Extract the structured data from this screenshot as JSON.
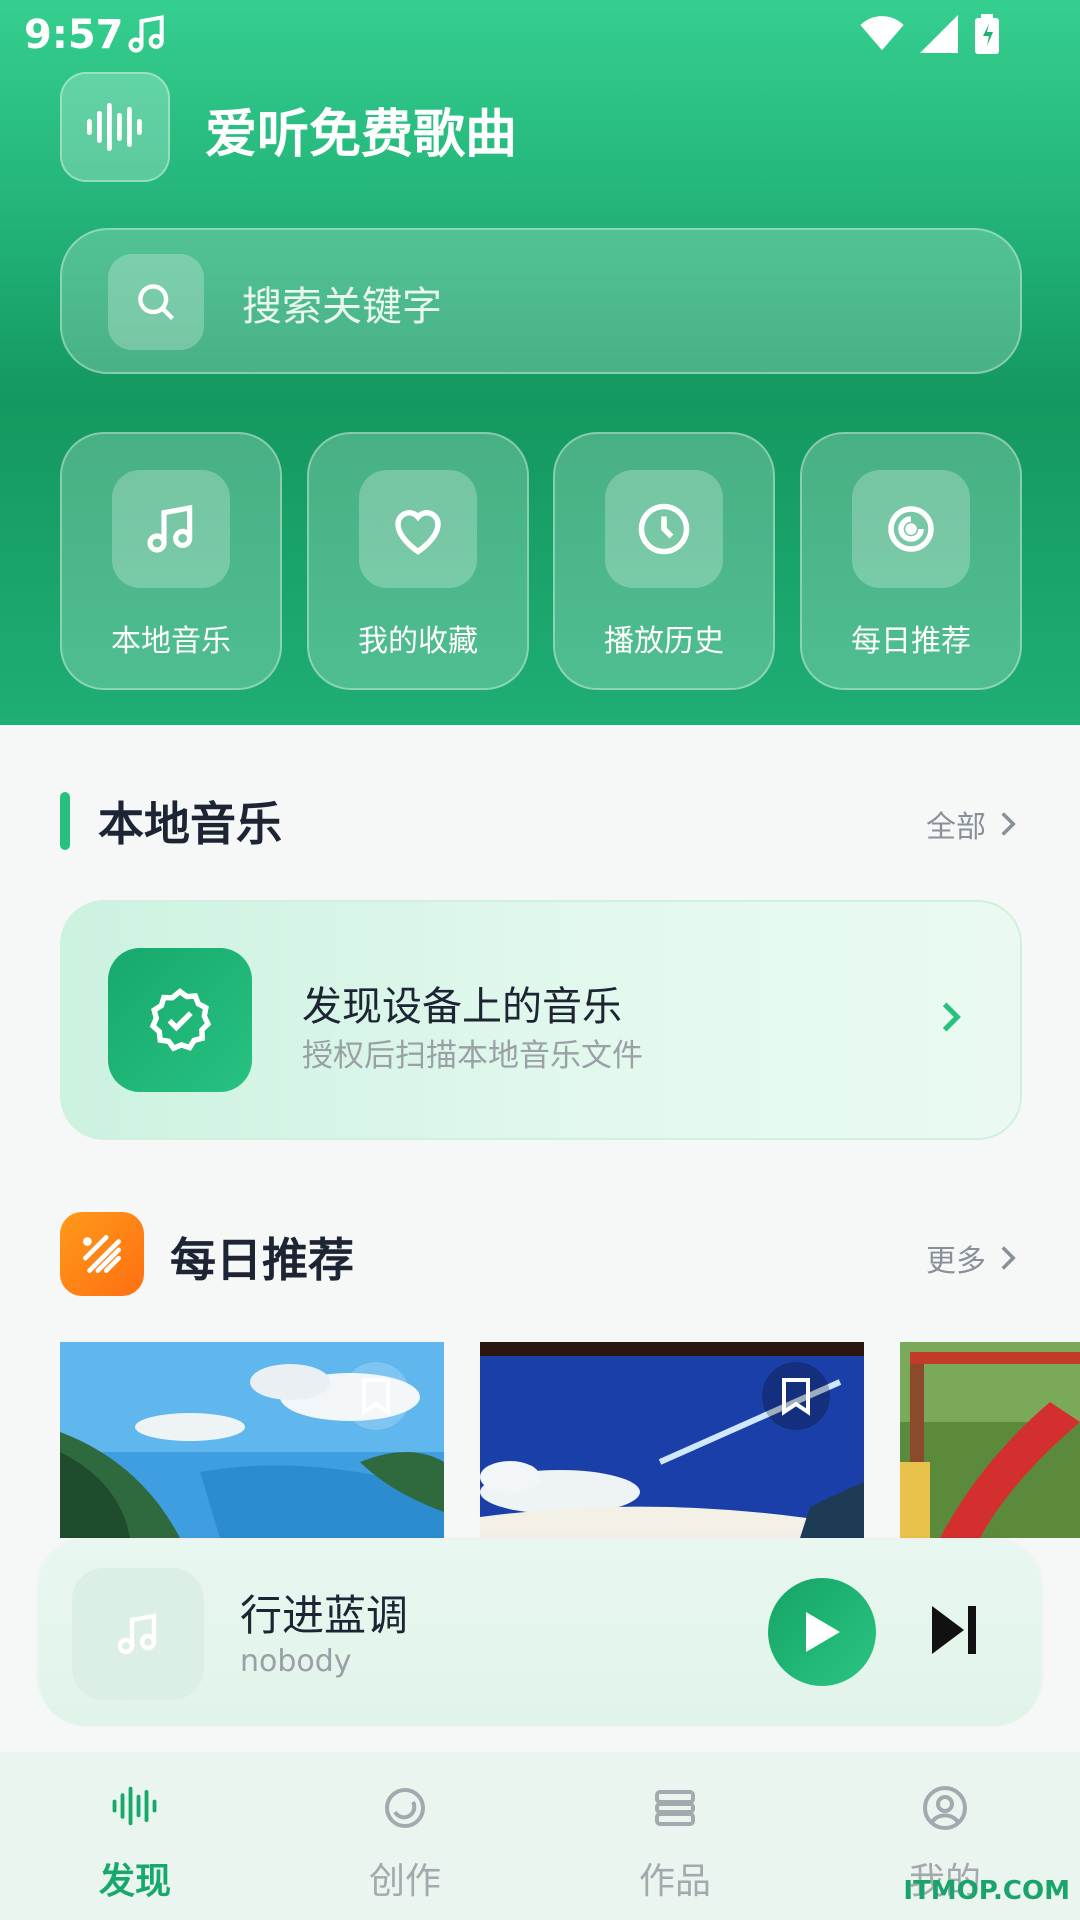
{
  "status_bar": {
    "time": "9:57"
  },
  "header": {
    "app_title": "爱听免费歌曲"
  },
  "search": {
    "placeholder": "搜索关键字"
  },
  "quick_actions": [
    {
      "label": "本地音乐",
      "icon": "music-note-icon"
    },
    {
      "label": "我的收藏",
      "icon": "heart-icon"
    },
    {
      "label": "播放历史",
      "icon": "clock-icon"
    },
    {
      "label": "每日推荐",
      "icon": "radio-signal-icon"
    }
  ],
  "local_music": {
    "title": "本地音乐",
    "more": "全部",
    "card_title": "发现设备上的音乐",
    "card_subtitle": "授权后扫描本地音乐文件"
  },
  "daily": {
    "title": "每日推荐",
    "more": "更多"
  },
  "player": {
    "title": "行进蓝调",
    "artist": "nobody"
  },
  "tabs": [
    {
      "label": "发现",
      "icon": "waveform-icon",
      "active": true
    },
    {
      "label": "创作",
      "icon": "disc-icon",
      "active": false
    },
    {
      "label": "作品",
      "icon": "stack-icon",
      "active": false
    },
    {
      "label": "我的",
      "icon": "user-icon",
      "active": false
    }
  ],
  "watermark": "ITMOP.COM",
  "colors": {
    "accent": "#17a86c",
    "orange": "#ff7a14",
    "hero_green": "#1fae74"
  }
}
